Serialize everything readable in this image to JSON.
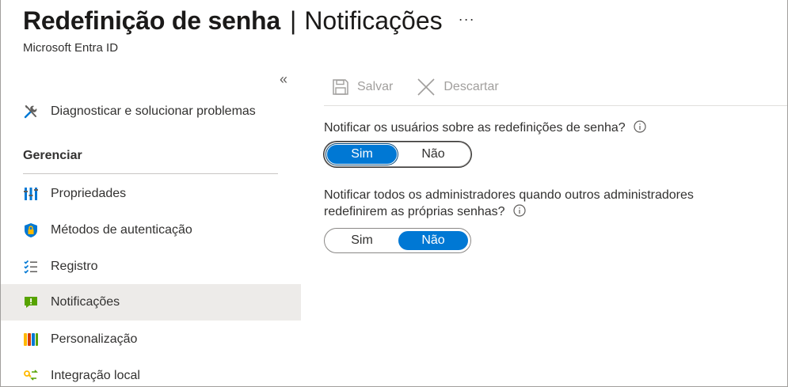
{
  "header": {
    "title": "Redefinição de senha",
    "separator": "|",
    "section": "Notificações",
    "more": "···",
    "subtitle": "Microsoft Entra ID"
  },
  "sidebar": {
    "collapse": "«",
    "top_item": {
      "label": "Diagnosticar e solucionar problemas",
      "icon": "wrench-screwdriver-icon"
    },
    "section_heading": "Gerenciar",
    "items": [
      {
        "label": "Propriedades",
        "icon": "properties-icon"
      },
      {
        "label": "Métodos de autenticação",
        "icon": "shield-lock-icon"
      },
      {
        "label": "Registro",
        "icon": "checklist-icon"
      },
      {
        "label": "Notificações",
        "icon": "notification-icon",
        "selected": true
      },
      {
        "label": "Personalização",
        "icon": "customization-icon"
      },
      {
        "label": "Integração local",
        "icon": "key-sync-icon"
      }
    ]
  },
  "toolbar": {
    "save_label": "Salvar",
    "discard_label": "Descartar"
  },
  "settings": {
    "notify_users": {
      "label": "Notificar os usuários sobre as redefinições de senha?",
      "yes": "Sim",
      "no": "Não",
      "value": "Sim"
    },
    "notify_admins": {
      "label_line1": "Notificar todos os administradores quando outros administradores",
      "label_line2": "redefinirem as próprias senhas?",
      "yes": "Sim",
      "no": "Não",
      "value": "Não"
    }
  },
  "colors": {
    "accent": "#0078d4",
    "selected_bg": "#edebe9",
    "disabled_text": "#a19f9d"
  }
}
